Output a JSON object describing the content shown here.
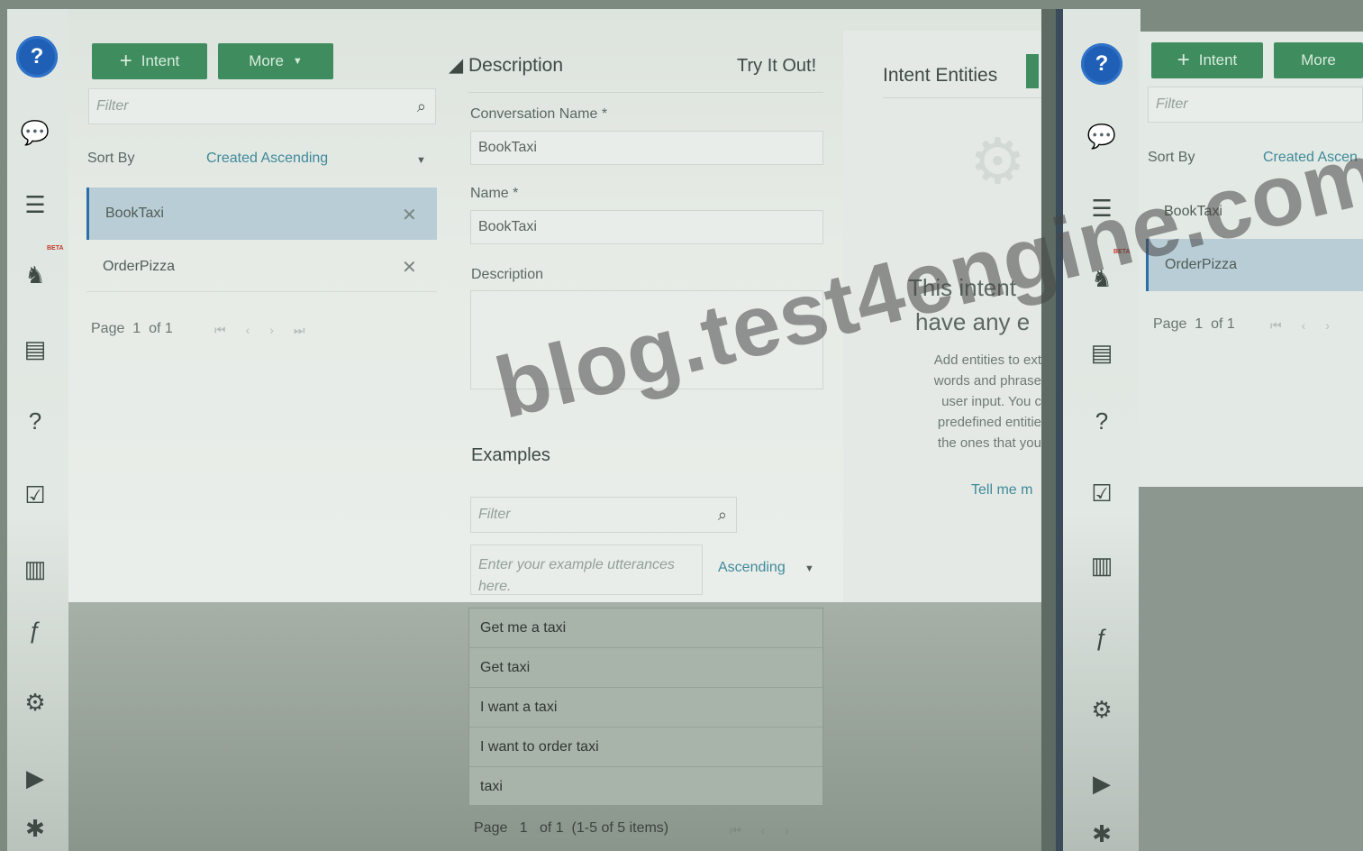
{
  "toolbar": {
    "intent_label": "Intent",
    "more_label": "More"
  },
  "list": {
    "filter_placeholder": "Filter",
    "sort_label": "Sort By",
    "sort_value": "Created Ascending",
    "items": [
      {
        "label": "BookTaxi",
        "selected": true
      },
      {
        "label": "OrderPizza",
        "selected": false
      }
    ],
    "pager": {
      "page_label": "Page",
      "page_num": "1",
      "of_label": "of 1"
    }
  },
  "form": {
    "section_title": "Description",
    "try_it_out": "Try It Out!",
    "conversation_name_label": "Conversation Name",
    "conversation_name_value": "BookTaxi",
    "name_label": "Name",
    "name_value": "BookTaxi",
    "description_label": "Description",
    "description_value": ""
  },
  "examples": {
    "title": "Examples",
    "filter_placeholder": "Filter",
    "utterance_placeholder": "Enter your example utterances here.",
    "sort_value": "Ascending",
    "items": [
      "Get me a taxi",
      "Get taxi",
      "I want a taxi",
      "I want to order taxi",
      "taxi"
    ],
    "pager": {
      "page_label": "Page",
      "page_num": "1",
      "of_label": "of 1",
      "items_label": "(1-5 of 5 items)"
    }
  },
  "entities": {
    "title": "Intent Entities",
    "empty_line1": "This intent",
    "empty_line2": "have any e",
    "help_lines": [
      "Add entities to ext",
      "words and phrase",
      "user input. You c",
      "predefined entitie",
      "the ones that you"
    ],
    "tell_me_more": "Tell me m"
  },
  "right_copy": {
    "intent_label": "Intent",
    "more_label": "More",
    "filter_placeholder": "Filter",
    "sort_label": "Sort By",
    "sort_value": "Created Ascen",
    "items": [
      "BookTaxi",
      "OrderPizza"
    ],
    "pager_page": "Page",
    "pager_num": "1",
    "pager_of": "of 1"
  },
  "rail": {
    "beta_label": "BETA"
  },
  "watermark": "blog.test4engine.com",
  "colors": {
    "accent_green": "#3f8d5f",
    "brand_blue": "#1f5fb5",
    "link_teal": "#3f8a9a"
  }
}
